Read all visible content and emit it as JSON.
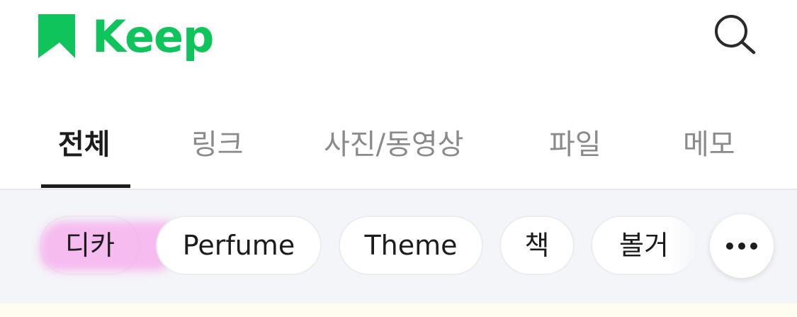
{
  "app": {
    "name": "Keep",
    "brand_color": "#10c45c"
  },
  "header": {
    "search_icon": "search-icon"
  },
  "tabs": [
    {
      "label": "전체",
      "active": true
    },
    {
      "label": "링크",
      "active": false
    },
    {
      "label": "사진/동영상",
      "active": false
    },
    {
      "label": "파일",
      "active": false
    },
    {
      "label": "메모",
      "active": false
    }
  ],
  "chips": [
    {
      "label": "디카",
      "highlighted": true
    },
    {
      "label": "Perfume"
    },
    {
      "label": "Theme"
    },
    {
      "label": "책"
    },
    {
      "label": "볼거"
    }
  ],
  "more_icon": "more-horizontal-icon"
}
